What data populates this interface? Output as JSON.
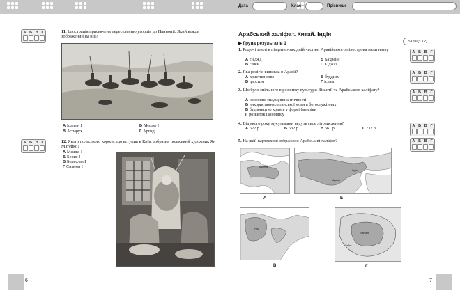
{
  "header": {
    "date_label": "Дата",
    "class_label": "Клас",
    "surname_label": "Прізвище"
  },
  "answer_letters": [
    "А",
    "Б",
    "В",
    "Г"
  ],
  "left_page": {
    "page_number": "6",
    "q11": {
      "number": "11.",
      "text": "Ілюстрація присвячена переселенню угорців до Паннонії. Який вождь зображений на ній?",
      "options": [
        {
          "letter": "А",
          "text": "Іштван І"
        },
        {
          "letter": "Б",
          "text": "Мешко І"
        },
        {
          "letter": "В",
          "text": "Аспарух"
        },
        {
          "letter": "Г",
          "text": "Арпад"
        }
      ]
    },
    "q12": {
      "number": "12.",
      "text": "Якого польського короля, що вступив в Київ, зобразив польський художник Ян Матейко?",
      "options": [
        {
          "letter": "А",
          "text": "Мешко І"
        },
        {
          "letter": "Б",
          "text": "Борис І"
        },
        {
          "letter": "В",
          "text": "Болеслав І"
        },
        {
          "letter": "Г",
          "text": "Симеон І"
        }
      ]
    }
  },
  "right_page": {
    "page_number": "7",
    "title": "Арабський халіфат. Китай. Індія",
    "group": "Група результатів 1",
    "score_tab": "Бали (з 12)",
    "q1": {
      "number": "1.",
      "text": "Родючі землі в південно-західній частині Аравійського півострова мали назву",
      "options": [
        {
          "letter": "А",
          "text": "Неджд"
        },
        {
          "letter": "Б",
          "text": "Бахрейн"
        },
        {
          "letter": "В",
          "text": "Ємен"
        },
        {
          "letter": "Г",
          "text": "Хіджаз"
        }
      ]
    },
    "q2": {
      "number": "2.",
      "text": "Яка релігія виникла в Аравії?",
      "options": [
        {
          "letter": "А",
          "text": "християнство"
        },
        {
          "letter": "Б",
          "text": "буддизм"
        },
        {
          "letter": "В",
          "text": "даосизм"
        },
        {
          "letter": "Г",
          "text": "іслам"
        }
      ]
    },
    "q3": {
      "number": "3.",
      "text": "Що було спільного в розвитку культури Візантії та Арабського халіфату?",
      "options": [
        {
          "letter": "А",
          "text": "освоєння спадщини античності"
        },
        {
          "letter": "Б",
          "text": "використання латинської мови в богослужінних"
        },
        {
          "letter": "В",
          "text": "будівництво храмів у формі базиліки"
        },
        {
          "letter": "Г",
          "text": "розвиток іконопису"
        }
      ]
    },
    "q4": {
      "number": "4.",
      "text": "Від якого року мусульмани ведуть своє літочислення?",
      "options": [
        {
          "letter": "А",
          "text": "622 р."
        },
        {
          "letter": "Б",
          "text": "632 р."
        },
        {
          "letter": "В",
          "text": "661 р."
        },
        {
          "letter": "Г",
          "text": "732 р."
        }
      ]
    },
    "q5": {
      "number": "5.",
      "text": "На якій картосхемі зображено Арабський халіфат?"
    },
    "map_labels": [
      "А",
      "Б",
      "В",
      "Г"
    ],
    "map_text": {
      "a": "Візантія",
      "b1": "Індія",
      "b2": "Аравія",
      "v": "Рим",
      "g1": "Чан'ань",
      "g2": "Тибет"
    }
  },
  "colors": {
    "strip": "#c8c8c8",
    "sea": "#ffffff",
    "land": "#d9d9d9"
  }
}
